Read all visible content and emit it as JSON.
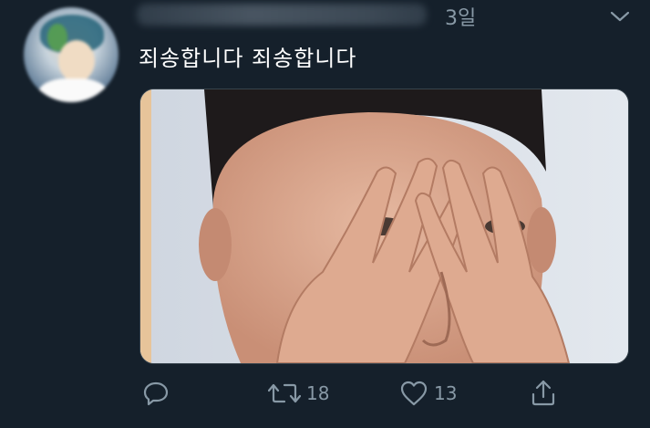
{
  "tweet": {
    "time": "3일",
    "text": "죄송합니다 죄송합니다"
  },
  "actions": {
    "retweet_count": "18",
    "like_count": "13"
  },
  "icons": {
    "reply": "reply-icon",
    "retweet": "retweet-icon",
    "like": "heart-icon",
    "share": "share-icon",
    "more": "chevron-down-icon"
  },
  "colors": {
    "background": "#15202b",
    "muted": "#8899a6",
    "text": "#ffffff"
  }
}
